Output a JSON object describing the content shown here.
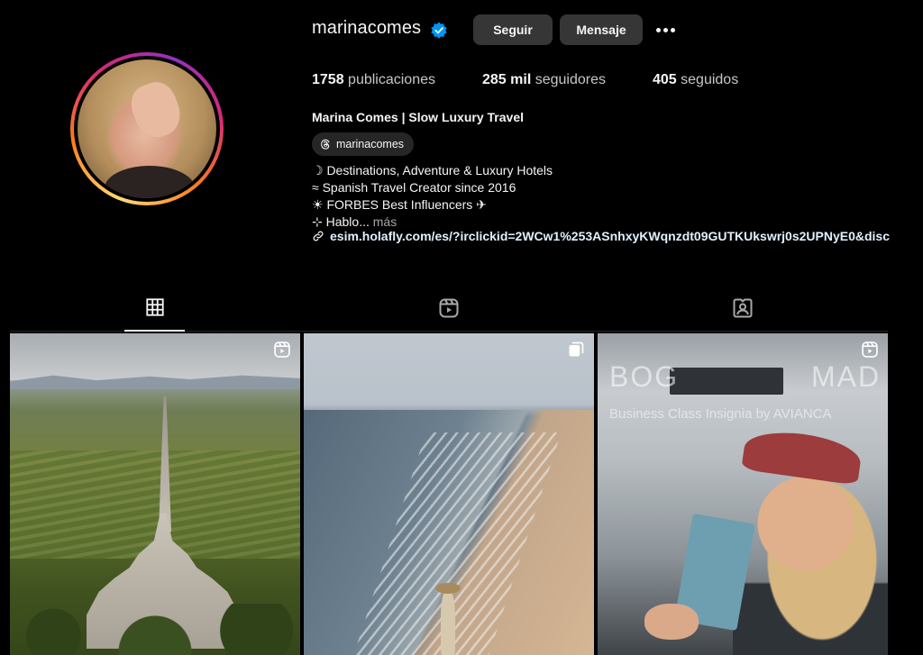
{
  "profile": {
    "username": "marinacomes",
    "verified": true,
    "follow_label": "Seguir",
    "message_label": "Mensaje",
    "stats": {
      "posts_value": "1758",
      "posts_label": "publicaciones",
      "followers_value": "285 mil",
      "followers_label": "seguidores",
      "following_value": "405",
      "following_label": "seguidos"
    },
    "full_name": "Marina Comes | Slow Luxury Travel",
    "threads_handle": "marinacomes",
    "bio": [
      "☽ Destinations, Adventure & Luxury Hotels",
      "≈ Spanish Travel Creator since 2016",
      "☀ FORBES Best Influencers ✈"
    ],
    "bio_truncated": "⊹ Hablo...",
    "bio_more": "más",
    "link": "esim.holafly.com/es/?irclickid=2WCw1%253ASnhxyKWqnzdt09GUTKUkswrj0s2UPNyE0&disc"
  },
  "tabs": [
    {
      "name": "posts",
      "icon": "grid-icon",
      "active": true
    },
    {
      "name": "reels",
      "icon": "reels-icon",
      "active": false
    },
    {
      "name": "tagged",
      "icon": "tagged-icon",
      "active": false
    }
  ],
  "posts": [
    {
      "type": "reel",
      "icon": "reel-icon",
      "description": "aerial church vineyard"
    },
    {
      "type": "carousel",
      "icon": "carousel-icon",
      "description": "beach aerial"
    },
    {
      "type": "reel",
      "icon": "reel-icon",
      "overlay_left": "BOG",
      "overlay_right": "MAD",
      "overlay_subtitle": "Business Class Insignia by AVIANCA"
    }
  ],
  "colors": {
    "background": "#000000",
    "button_bg": "#363636",
    "verified_blue": "#0095f6",
    "link_color": "#e0f1ff",
    "muted_text": "#a8a8a8"
  }
}
